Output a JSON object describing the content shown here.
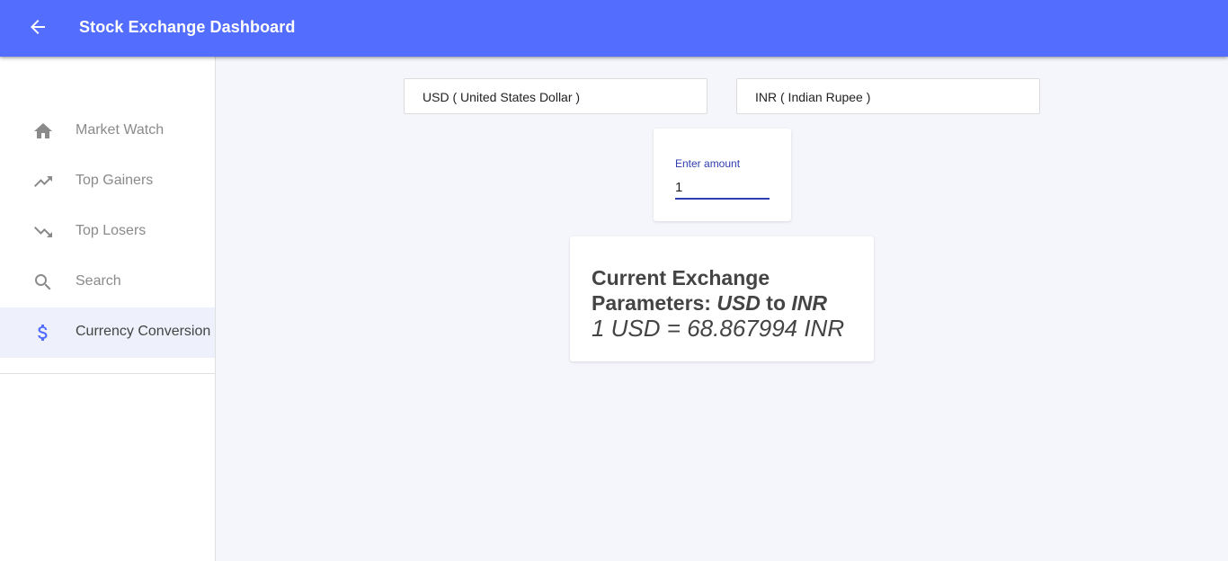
{
  "appbar": {
    "title": "Stock Exchange Dashboard",
    "back_icon": "arrow-left-icon",
    "color": "#536dfe"
  },
  "sidebar": {
    "items": [
      {
        "label": "Market Watch",
        "icon": "home-icon",
        "active": false
      },
      {
        "label": "Top Gainers",
        "icon": "trending-up-icon",
        "active": false
      },
      {
        "label": "Top Losers",
        "icon": "trending-down-icon",
        "active": false
      },
      {
        "label": "Search",
        "icon": "search-icon",
        "active": false
      },
      {
        "label": "Currency Conversion",
        "icon": "dollar-icon",
        "active": true
      }
    ],
    "active_color": "#536dfe"
  },
  "converter": {
    "from_currency": "USD ( United States Dollar )",
    "to_currency": "INR ( Indian Rupee )",
    "amount_label": "Enter amount",
    "amount_value": "1"
  },
  "result": {
    "heading_prefix": "Current Exchange Parameters: ",
    "from_code": "USD",
    "connector": " to ",
    "to_code": "INR",
    "rate_line": "1 USD = 68.867994 INR"
  }
}
